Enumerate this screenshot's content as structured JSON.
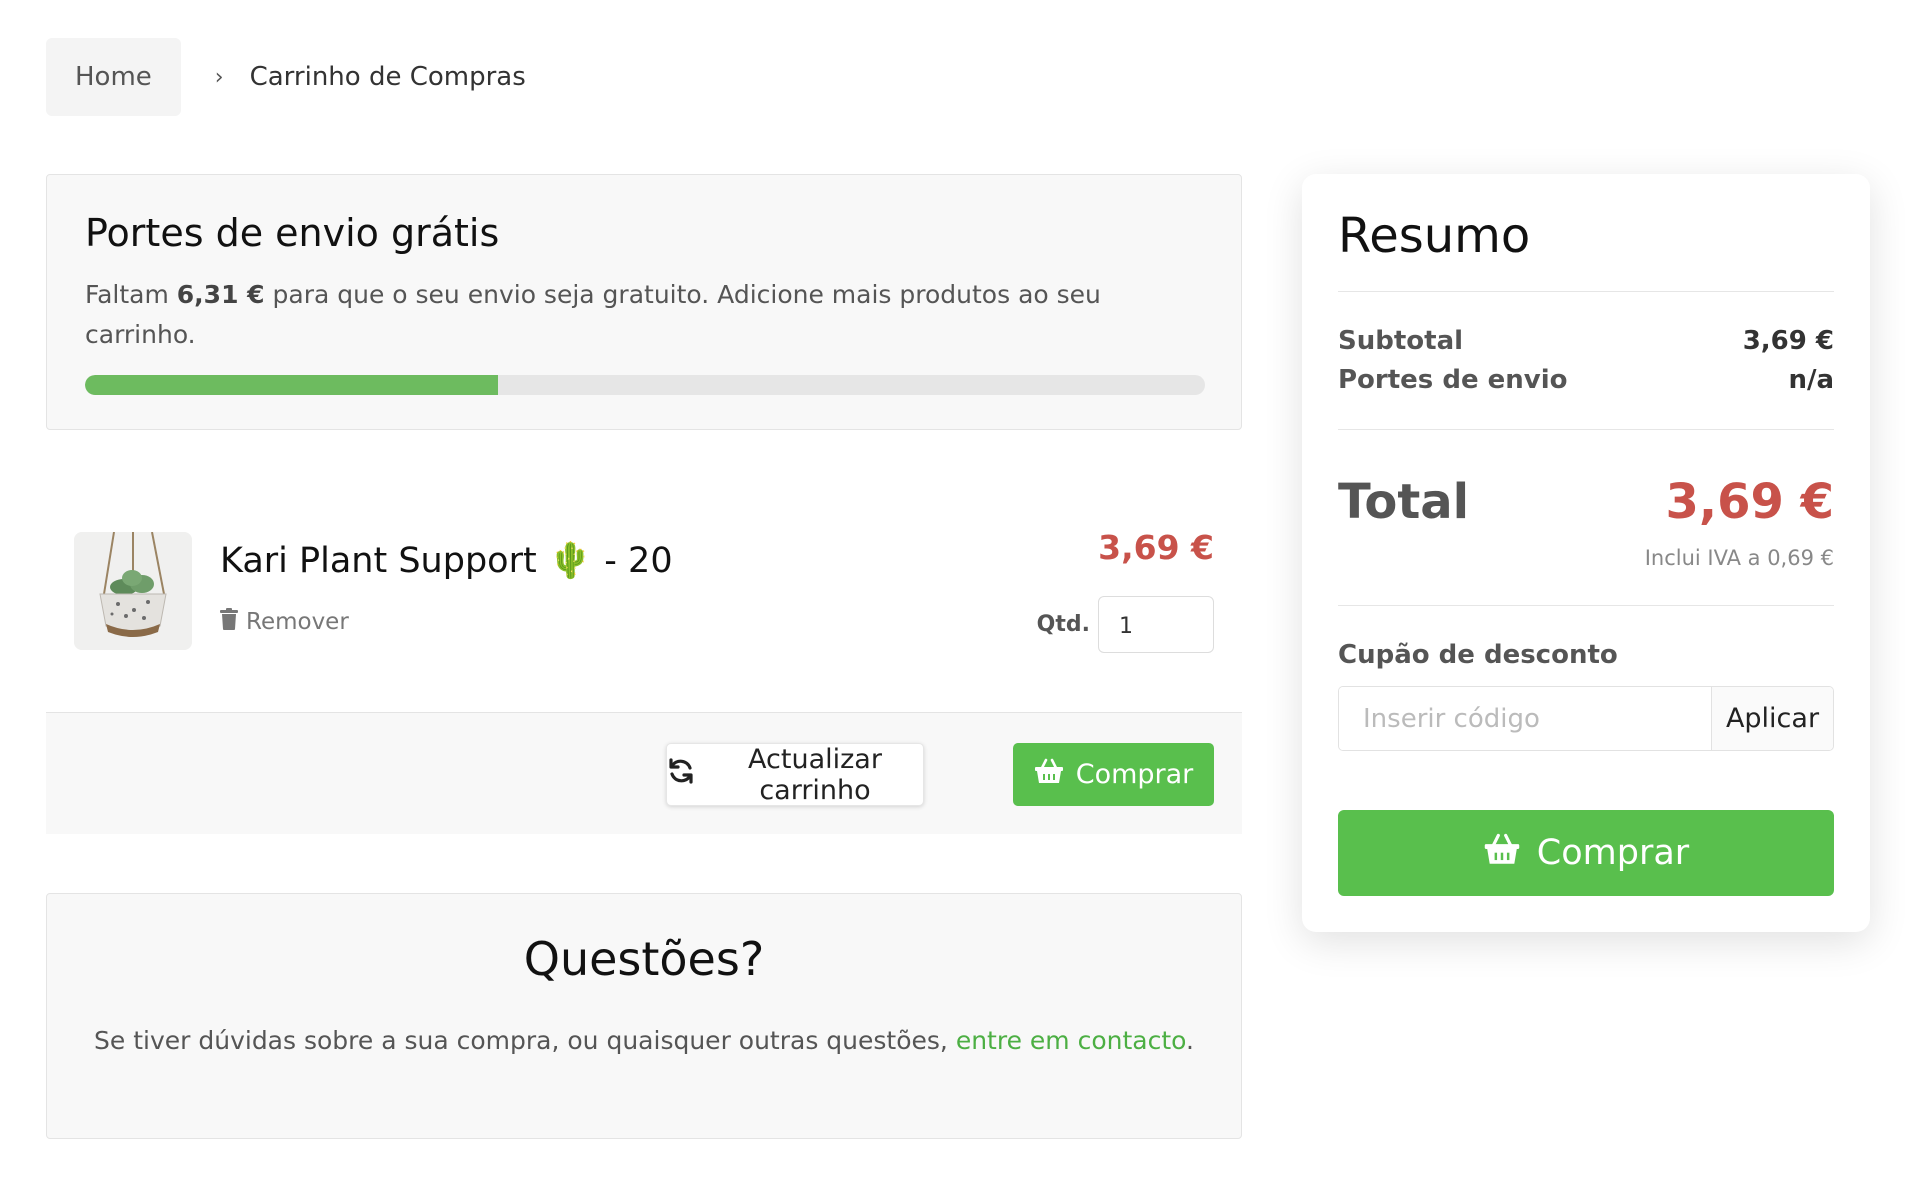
{
  "breadcrumb": {
    "home": "Home",
    "separator": "›",
    "current": "Carrinho de Compras"
  },
  "shipping": {
    "title": "Portes de envio grátis",
    "text_before": "Faltam ",
    "amount_missing": "6,31 €",
    "text_after": " para que o seu envio seja gratuito. Adicione mais produtos ao seu carrinho.",
    "progress_fraction": 0.369,
    "progress_color": "#6dbb5f"
  },
  "cart": {
    "items": [
      {
        "name": "Kari Plant Support",
        "emoji": "🌵",
        "variant": "- 20",
        "remove_label": "Remover",
        "price": "3,69 €",
        "qty_label": "Qtd.",
        "qty_value": "1"
      }
    ],
    "update_label": "Actualizar carrinho",
    "buy_label": "Comprar"
  },
  "questions": {
    "title": "Questões?",
    "text": "Se tiver dúvidas sobre a sua compra, ou quaisquer outras questões, ",
    "link": "entre em contacto",
    "text_end": "."
  },
  "summary": {
    "title": "Resumo",
    "subtotal_label": "Subtotal",
    "subtotal_value": "3,69 €",
    "shipping_label": "Portes de envio",
    "shipping_value": "n/a",
    "total_label": "Total",
    "total_value": "3,69 €",
    "tax_note": "Inclui IVA a 0,69 €",
    "coupon_label": "Cupão de desconto",
    "coupon_placeholder": "Inserir código",
    "coupon_apply": "Aplicar",
    "buy_label": "Comprar"
  },
  "colors": {
    "accent_green": "#59bf4d",
    "price_red": "#c8524a",
    "link_green": "#4caf43"
  },
  "icons": {
    "trash": "trash-icon",
    "refresh": "refresh-icon",
    "basket": "basket-icon"
  }
}
